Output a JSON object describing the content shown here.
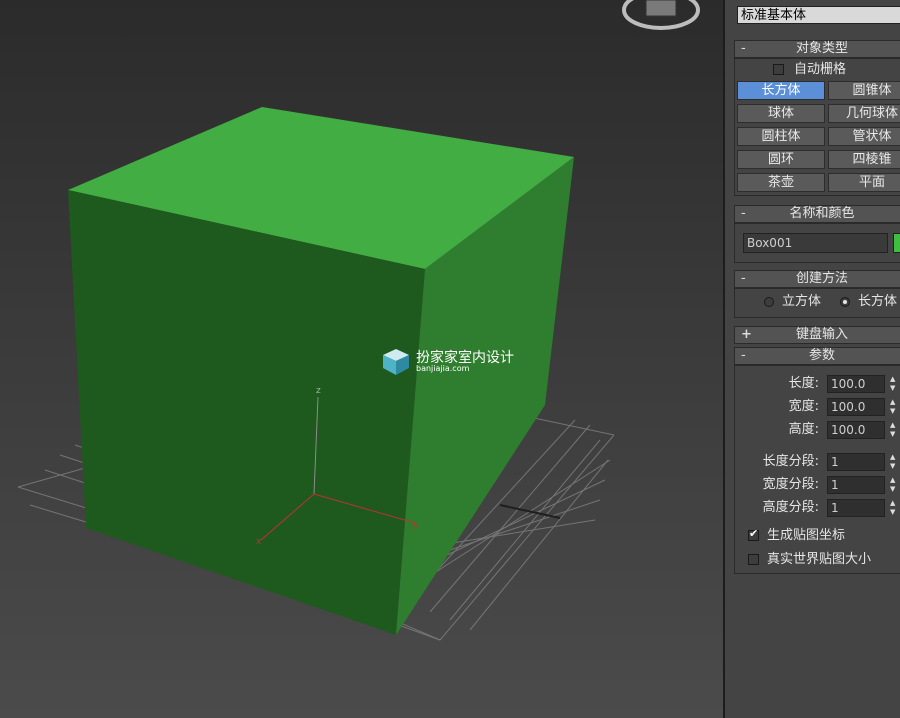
{
  "viewport": {
    "cube_color": "#3a9e3a",
    "axis_labels": {
      "x": "x",
      "y": "y",
      "z": "z"
    },
    "watermark": {
      "title": "扮家家室内设计",
      "url": "banjiajia.com"
    }
  },
  "panel": {
    "category_dropdown": "标准基本体",
    "object_type": {
      "header": "对象类型",
      "autogrid_label": "自动栅格",
      "autogrid_checked": false,
      "buttons": [
        "长方体",
        "圆锥体",
        "球体",
        "几何球体",
        "圆柱体",
        "管状体",
        "圆环",
        "四棱锥",
        "茶壶",
        "平面"
      ],
      "active_button": "长方体"
    },
    "name_color": {
      "header": "名称和颜色",
      "name_value": "Box001",
      "swatch_color": "#3fbf3f"
    },
    "creation_method": {
      "header": "创建方法",
      "option_cube": "立方体",
      "option_box": "长方体",
      "selected": "长方体"
    },
    "keyboard_entry": {
      "sign": "+",
      "header": "键盘输入"
    },
    "parameters": {
      "sign": "-",
      "header": "参数",
      "length_label": "长度:",
      "length_value": "100.0",
      "width_label": "宽度:",
      "width_value": "100.0",
      "height_label": "高度:",
      "height_value": "100.0",
      "length_segs_label": "长度分段:",
      "length_segs_value": "1",
      "width_segs_label": "宽度分段:",
      "width_segs_value": "1",
      "height_segs_label": "高度分段:",
      "height_segs_value": "1",
      "gen_map_coords_label": "生成贴图坐标",
      "gen_map_coords_checked": true,
      "real_world_label": "真实世界贴图大小",
      "real_world_checked": false
    },
    "collapse_sign": "-"
  }
}
